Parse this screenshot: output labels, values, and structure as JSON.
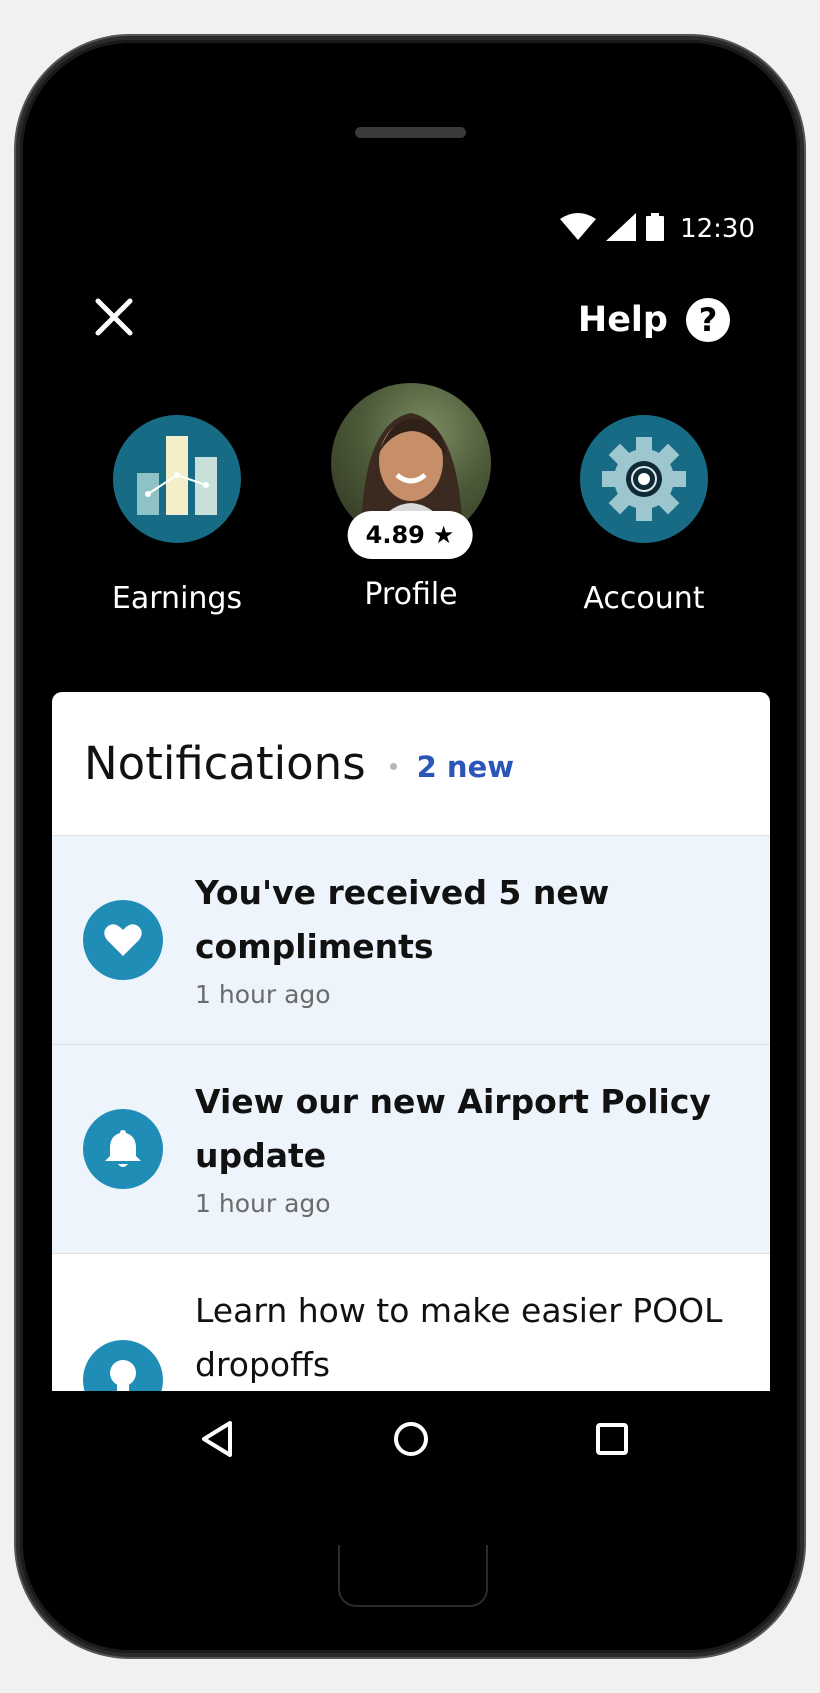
{
  "status_bar": {
    "time": "12:30"
  },
  "header": {
    "help_label": "Help",
    "help_icon_glyph": "?"
  },
  "shortcuts": {
    "earnings": {
      "label": "Earnings",
      "icon": "bar-chart-icon"
    },
    "profile": {
      "label": "Profile",
      "rating": "4.89",
      "rating_icon": "★"
    },
    "account": {
      "label": "Account",
      "icon": "gear-icon"
    }
  },
  "notifications": {
    "title": "Notifications",
    "new_count": "2 new",
    "items": [
      {
        "title": "You've received 5 new compliments",
        "time": "1 hour ago",
        "icon": "heart-icon",
        "unread": true
      },
      {
        "title": "View our new Airport Policy update",
        "time": "1 hour ago",
        "icon": "bell-icon",
        "unread": true
      },
      {
        "title": "Learn how to make easier POOL dropoffs",
        "time": "",
        "icon": "lightbulb-icon",
        "unread": false
      }
    ]
  },
  "colors": {
    "accent_teal": "#176b85",
    "notif_icon_blue": "#1f8db6",
    "new_count_blue": "#2a56b7",
    "unread_bg": "#eef4fb"
  }
}
